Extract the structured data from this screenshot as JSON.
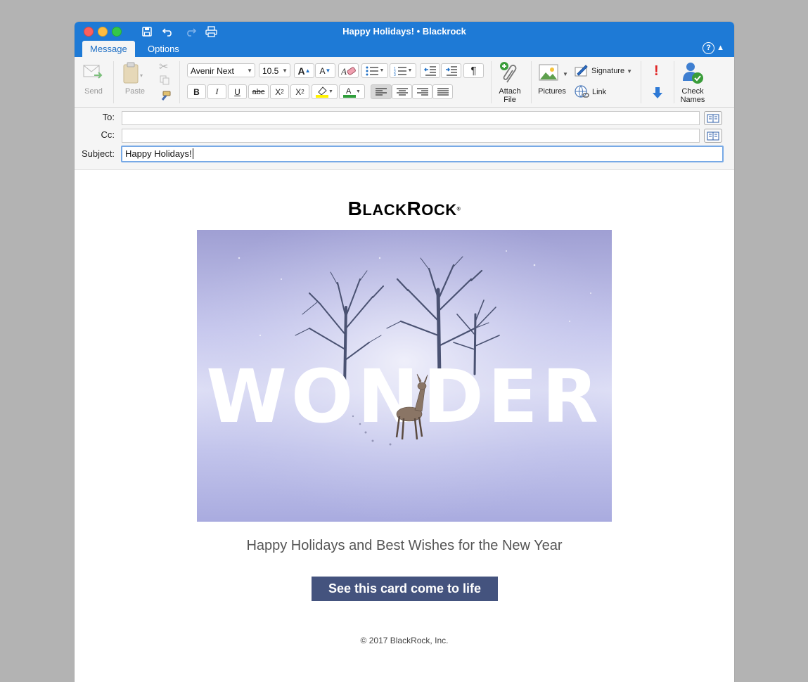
{
  "window": {
    "title": "Happy Holidays! • Blackrock"
  },
  "tabs": [
    {
      "label": "Message"
    },
    {
      "label": "Options"
    }
  ],
  "ribbon": {
    "send_label": "Send",
    "paste_label": "Paste",
    "font_name": "Avenir Next",
    "font_size": "10.5",
    "bold": "B",
    "italic": "I",
    "underline": "U",
    "strikethrough": "abc",
    "pilcrow": "¶",
    "attach_label_1": "Attach",
    "attach_label_2": "File",
    "pictures_label": "Pictures",
    "signature_label": "Signature",
    "link_label": "Link",
    "check_names_1": "Check",
    "check_names_2": "Names"
  },
  "header": {
    "to_label": "To:",
    "cc_label": "Cc:",
    "subject_label": "Subject:",
    "to_value": "",
    "cc_value": "",
    "subject_value": "Happy Holidays!"
  },
  "message": {
    "logo_text": "BLACKROCK",
    "hero_text": "WONDER",
    "greeting": "Happy Holidays and Best Wishes for the New Year",
    "cta_label": "See this card come to life",
    "copyright": "© 2017 BlackRock, Inc."
  },
  "colors": {
    "titlebar": "#1e7ad6",
    "cta": "#44537e"
  }
}
